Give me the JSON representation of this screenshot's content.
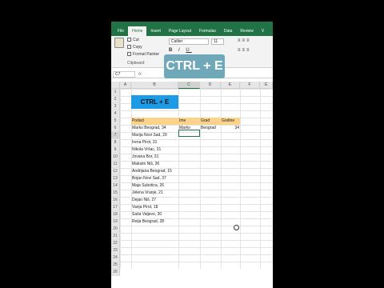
{
  "ribbon": {
    "tabs": [
      "File",
      "Home",
      "Insert",
      "Page Layout",
      "Formulas",
      "Data",
      "Review",
      "V"
    ],
    "active_tab": "Home",
    "clipboard": {
      "cut": "Cut",
      "copy": "Copy",
      "format_painter": "Format Painter",
      "group_label": "Clipboard"
    },
    "font_name": "Calibri",
    "font_size": "11"
  },
  "overlay_text": "CTRL + E",
  "formula_bar": {
    "name_box": "C7",
    "fx": "fx"
  },
  "columns": [
    "A",
    "B",
    "C",
    "D",
    "E",
    "F",
    "G"
  ],
  "selected_column": "C",
  "selected_row": "7",
  "rows": [
    "1",
    "2",
    "3",
    "4",
    "5",
    "6",
    "7",
    "8",
    "9",
    "10",
    "11",
    "12",
    "13",
    "14",
    "15",
    "16",
    "17",
    "18",
    "19",
    "20",
    "21",
    "22",
    "23",
    "24",
    "25",
    "26"
  ],
  "sheet": {
    "banner": "CTRL + E",
    "headers": [
      "Podaci",
      "Ime",
      "Grad",
      "Godine"
    ],
    "row6": {
      "ime": "Marko",
      "grad": "Beograd",
      "godine": "34"
    },
    "data": [
      "Marko Beograd, 34",
      "Marija Novi Sad, 29",
      "Irena Pirot, 31",
      "Nikola Vršac, 31",
      "Jovana Bor, 31",
      "Maksim Niš, 36",
      "Andrijana Beograd, 15",
      "Bojan Novi Sad, 37",
      "Maja Subotica, 26",
      "Jelena Vranje, 21",
      "Dejan Niš, 27",
      "Vanja Pirot, 18",
      "Saša Valjevo, 30",
      "Reija Beograd, 28"
    ]
  }
}
